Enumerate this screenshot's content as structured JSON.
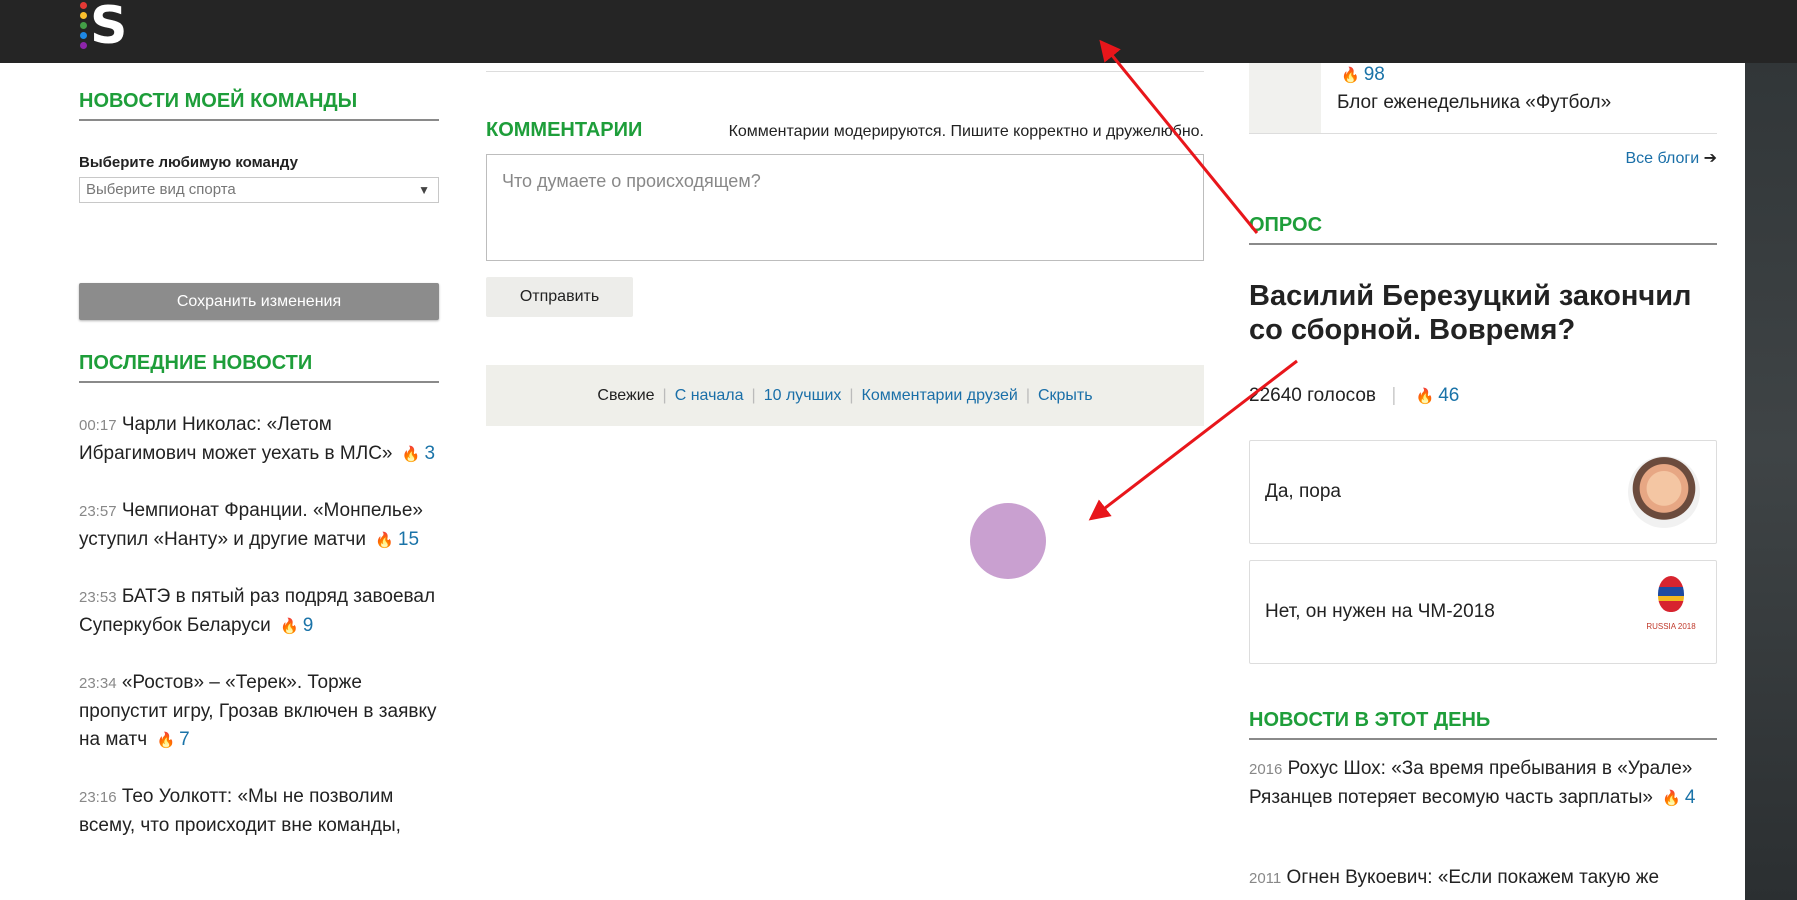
{
  "brand": {
    "logo_letter": "S",
    "dot_colors": [
      "#e53935",
      "#fbc02d",
      "#43a047",
      "#1e88e5",
      "#8e24aa"
    ]
  },
  "left": {
    "my_team_title": "НОВОСТИ МОЕЙ КОМАНДЫ",
    "fav_label": "Выберите любимую команду",
    "select_placeholder": "Выберите вид спорта",
    "save_label": "Сохранить изменения",
    "latest_title": "ПОСЛЕДНИЕ НОВОСТИ",
    "news": [
      {
        "time": "00:17",
        "text": "Чарли Николас: «Летом Ибрагимович может уехать в МЛС»",
        "count": "3"
      },
      {
        "time": "23:57",
        "text": "Чемпионат Франции. «Монпелье» уступил «Нанту» и другие матчи",
        "count": "15"
      },
      {
        "time": "23:53",
        "text": "БАТЭ в пятый раз подряд завоевал Суперкубок Беларуси",
        "count": "9"
      },
      {
        "time": "23:34",
        "text": "«Ростов» – «Терек». Торже пропустит игру, Грозав включен в заявку на матч",
        "count": "7"
      },
      {
        "time": "23:16",
        "text": "Тео Уолкотт: «Мы не позволим всему, что происходит вне команды,",
        "count": ""
      }
    ]
  },
  "mid": {
    "comments_title": "КОММЕНТАРИИ",
    "comments_note": "Комментарии модерируются. Пишите корректно и дружелюбно.",
    "comment_placeholder": "Что думаете о происходящем?",
    "send_label": "Отправить",
    "sort": {
      "fresh": "Свежие",
      "from_start": "С начала",
      "top10": "10 лучших",
      "friends": "Комментарии друзей",
      "hide": "Скрыть"
    }
  },
  "right": {
    "blog_count": "98",
    "blog_name": "Блог еженедельника «Футбол»",
    "all_blogs": "Все блоги",
    "poll_title": "ОПРОС",
    "poll_question": "Василий Березуцкий закончил со сборной. Вовремя?",
    "poll_votes": "22640 голосов",
    "poll_count": "46",
    "options": [
      {
        "label": "Да, пора",
        "image_icon": "player-photo"
      },
      {
        "label": "Нет, он нужен на ЧМ-2018",
        "image_icon": "world-cup-2018-logo",
        "logo_caption": "RUSSIA 2018"
      }
    ],
    "day_title": "НОВОСТИ В ЭТОТ ДЕНЬ",
    "day_news": [
      {
        "year": "2016",
        "text": "Рохус Шох: «За время пребывания в «Урале» Рязанцев потеряет весомую часть зарплаты»",
        "count": "4"
      },
      {
        "year": "2011",
        "text": "Огнен Вукоевич: «Если покажем такую же",
        "count": ""
      }
    ]
  },
  "annotation": {
    "arrow_color": "#e8161b",
    "marker_color": "#c9a0d0"
  }
}
